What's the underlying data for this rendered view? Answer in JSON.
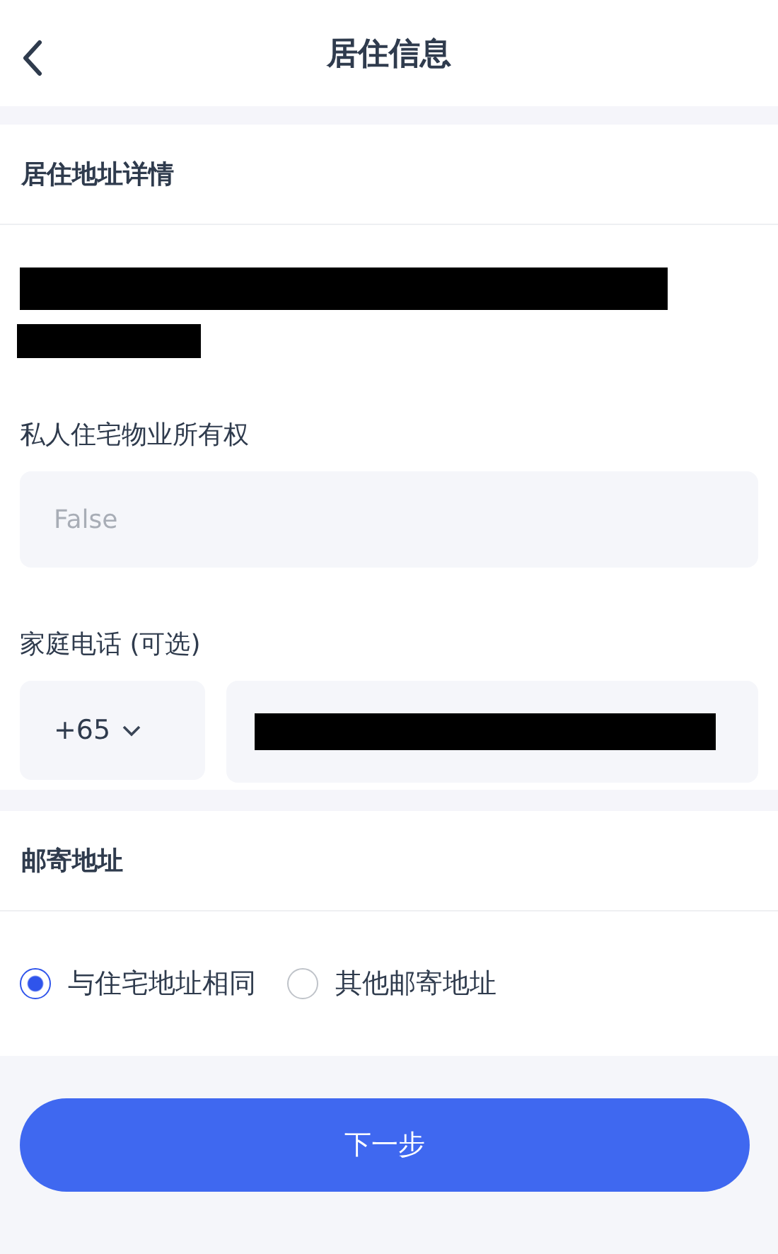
{
  "header": {
    "title": "居住信息"
  },
  "residential": {
    "title": "居住地址详情",
    "redacted_lines": [
      {
        "kind": "long"
      },
      {
        "kind": "short"
      }
    ],
    "ownership": {
      "label": "私人住宅物业所有权",
      "value": "False",
      "disabled": true
    },
    "phone": {
      "label": "家庭电话 (可选)",
      "country_code": "+65",
      "number_redacted": true
    }
  },
  "mailing": {
    "title": "邮寄地址",
    "options": [
      {
        "label": "与住宅地址相同",
        "selected": true
      },
      {
        "label": "其他邮寄地址",
        "selected": false
      }
    ]
  },
  "next_button": "下一步"
}
